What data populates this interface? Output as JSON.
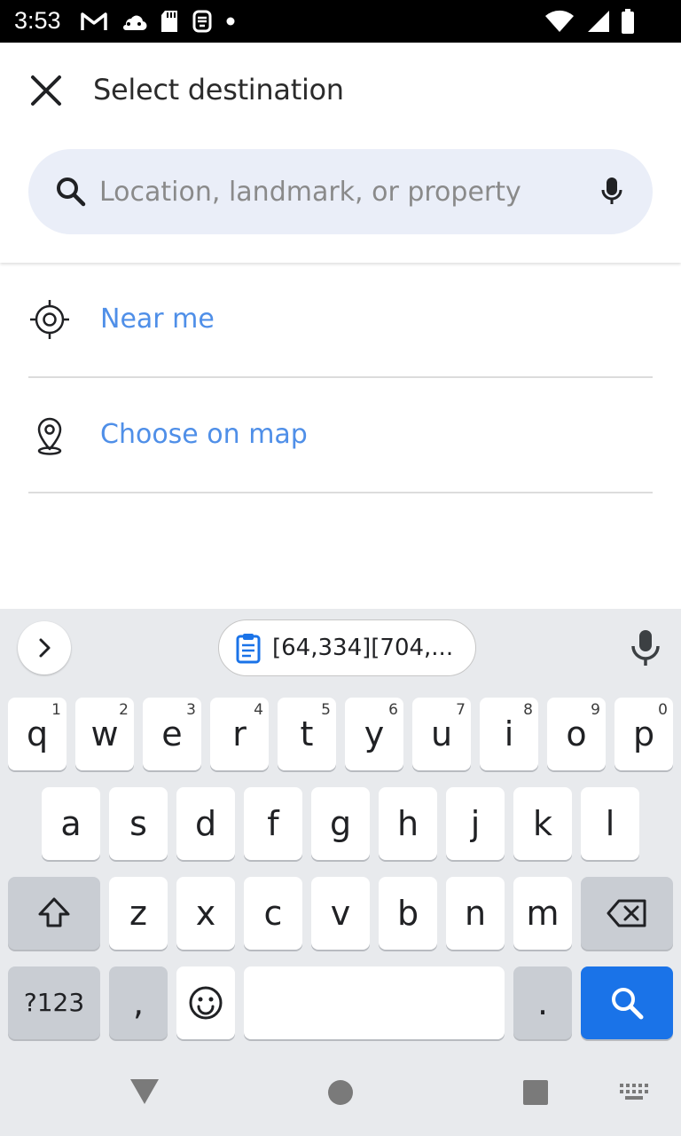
{
  "status_bar": {
    "time": "3:53",
    "left_icons": [
      "gmail-icon",
      "cloud-icon",
      "sd-card-icon",
      "app-icon",
      "dot-icon"
    ],
    "right_icons": [
      "wifi-icon",
      "signal-icon",
      "battery-icon"
    ]
  },
  "header": {
    "title": "Select destination",
    "close_icon": "close-icon"
  },
  "search": {
    "placeholder": "Location, landmark, or property",
    "value": ""
  },
  "options": [
    {
      "label": "Near me",
      "icon": "target-icon"
    },
    {
      "label": "Choose on map",
      "icon": "map-pin-icon"
    }
  ],
  "accent_color": "#4f8fe8",
  "keyboard": {
    "clipboard_text": "[64,334][704,...",
    "row1": [
      {
        "label": "q",
        "hint": "1"
      },
      {
        "label": "w",
        "hint": "2"
      },
      {
        "label": "e",
        "hint": "3"
      },
      {
        "label": "r",
        "hint": "4"
      },
      {
        "label": "t",
        "hint": "5"
      },
      {
        "label": "y",
        "hint": "6"
      },
      {
        "label": "u",
        "hint": "7"
      },
      {
        "label": "i",
        "hint": "8"
      },
      {
        "label": "o",
        "hint": "9"
      },
      {
        "label": "p",
        "hint": "0"
      }
    ],
    "row2": [
      "a",
      "s",
      "d",
      "f",
      "g",
      "h",
      "j",
      "k",
      "l"
    ],
    "row3": [
      "z",
      "x",
      "c",
      "v",
      "b",
      "n",
      "m"
    ],
    "symbols_label": "?123",
    "comma_label": ",",
    "period_label": "."
  },
  "nav_bar": {
    "icons": [
      "back-icon",
      "home-icon",
      "recents-icon",
      "keyboard-switch-icon"
    ]
  }
}
